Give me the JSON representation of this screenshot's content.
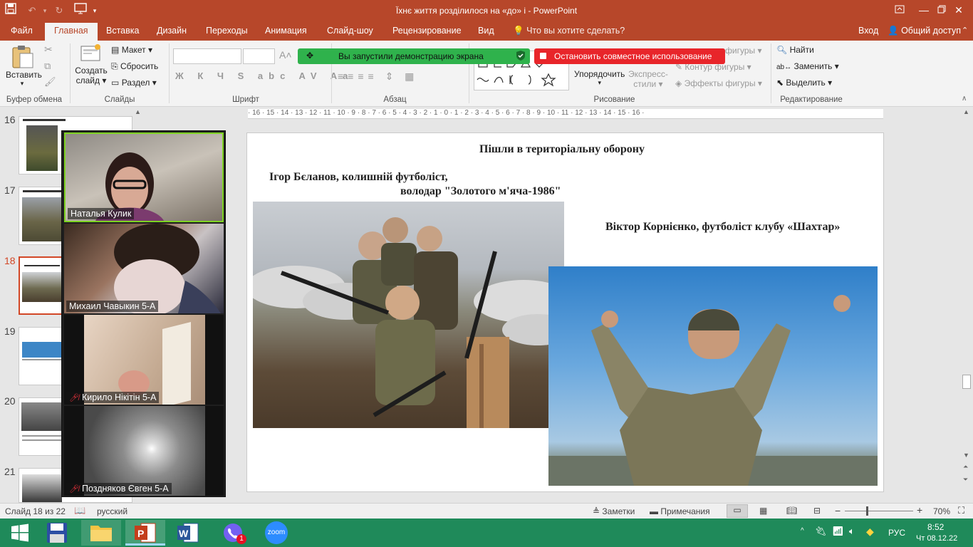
{
  "window": {
    "title": "Їхнє життя розділилося на «до» і - PowerPoint"
  },
  "tabs": [
    "Файл",
    "Главная",
    "Вставка",
    "Дизайн",
    "Переходы",
    "Анимация",
    "Слайд-шоу",
    "Рецензирование",
    "Вид"
  ],
  "tell_me": "Что вы хотите сделать?",
  "account": {
    "signin": "Вход",
    "share": "Общий доступ"
  },
  "ribbon": {
    "clipboard": {
      "label": "Буфер обмена",
      "paste": "Вставить"
    },
    "slides": {
      "label": "Слайды",
      "new_slide_line1": "Создать",
      "new_slide_line2": "слайд",
      "layout": "Макет",
      "reset": "Сбросить",
      "section": "Раздел"
    },
    "font": {
      "label": "Шрифт"
    },
    "paragraph": {
      "label": "Абзац"
    },
    "drawing": {
      "label": "Рисование",
      "arrange": "Упорядочить",
      "quick_styles_line1": "Экспресс-",
      "quick_styles_line2": "стили",
      "shape_fill": "фигуры",
      "shape_outline": "Контур фигуры",
      "shape_effects": "Эффекты фигуры"
    },
    "editing": {
      "label": "Редактирование",
      "find": "Найти",
      "replace": "Заменить",
      "select": "Выделить"
    }
  },
  "share_banner": {
    "notice": "Вы запустили демонстрацию экрана",
    "stop": "Остановить совместное использование"
  },
  "thumbnails": [
    {
      "num": "16"
    },
    {
      "num": "17"
    },
    {
      "num": "18",
      "selected": true
    },
    {
      "num": "19"
    },
    {
      "num": "20"
    },
    {
      "num": "21"
    }
  ],
  "ruler": "· 16 · 15 · 14 · 13 · 12 · 11 · 10 · 9 · 8 · 7 · 6 · 5 · 4 · 3 · 2 · 1 · 0 · 1 · 2 · 3 · 4 · 5 · 6 · 7 · 8 · 9 · 10 · 11 · 12 · 13 · 14 · 15 · 16 ·",
  "slide": {
    "heading": "Пішли в територіальну оборону",
    "caption_left_line1": "Ігор Бєланов, колишній футболіст,",
    "caption_left_line2": "володар \"Золотого м'яча-1986\"",
    "caption_right": "Віктор Корнієнко, футболіст клубу «Шахтар»"
  },
  "participants": [
    {
      "name": "Наталья Кулик",
      "muted": false
    },
    {
      "name": "Михаил Чавыкин 5-А",
      "muted": false
    },
    {
      "name": "Кирило Нікітін 5-А",
      "muted": true
    },
    {
      "name": "Поздняков Євген 5-А",
      "muted": true
    }
  ],
  "status": {
    "slide_info": "Слайд 18 из 22",
    "language": "русский",
    "notes": "Заметки",
    "comments": "Примечания",
    "zoom": "70%"
  },
  "taskbar": {
    "viber_badge": "1",
    "zoom_label": "zoom",
    "lang": "РУС",
    "time": "8:52",
    "date": "Чт 08.12.22"
  },
  "colors": {
    "accent": "#b7472a",
    "taskbar": "#1f8a5a",
    "share_green": "#2fb24c",
    "share_red": "#e8252a"
  }
}
